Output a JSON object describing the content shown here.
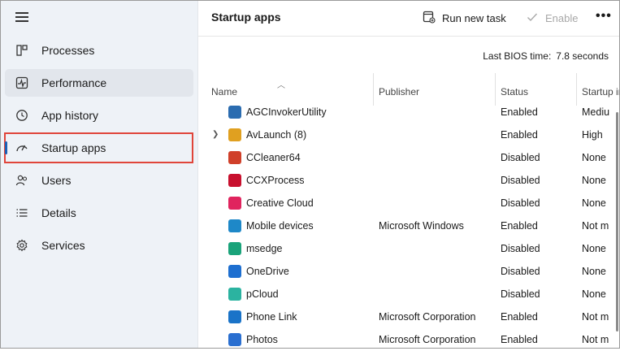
{
  "sidebar": {
    "items": [
      {
        "key": "processes",
        "label": "Processes",
        "icon": "processes-icon"
      },
      {
        "key": "performance",
        "label": "Performance",
        "icon": "performance-icon"
      },
      {
        "key": "app-history",
        "label": "App history",
        "icon": "history-icon"
      },
      {
        "key": "startup-apps",
        "label": "Startup apps",
        "icon": "startup-gauge-icon"
      },
      {
        "key": "users",
        "label": "Users",
        "icon": "users-icon"
      },
      {
        "key": "details",
        "label": "Details",
        "icon": "details-list-icon"
      },
      {
        "key": "services",
        "label": "Services",
        "icon": "services-gear-icon"
      }
    ],
    "selected": "Startup apps"
  },
  "header": {
    "title": "Startup apps",
    "run_new_task": "Run new task",
    "enable": "Enable",
    "more": "•••"
  },
  "bios": {
    "label": "Last BIOS time:",
    "value": "7.8 seconds"
  },
  "columns": {
    "name": "Name",
    "publisher": "Publisher",
    "status": "Status",
    "impact": "Startup im"
  },
  "rows": [
    {
      "name": "AGCInvokerUtility",
      "publisher": "",
      "status": "Enabled",
      "impact": "Mediu",
      "color": "#2b6cb0"
    },
    {
      "name": "AvLaunch (8)",
      "publisher": "",
      "status": "Enabled",
      "impact": "High",
      "color": "#e0a020",
      "expandable": true
    },
    {
      "name": "CCleaner64",
      "publisher": "",
      "status": "Disabled",
      "impact": "None",
      "color": "#d0402a"
    },
    {
      "name": "CCXProcess",
      "publisher": "",
      "status": "Disabled",
      "impact": "None",
      "color": "#c8102e"
    },
    {
      "name": "Creative Cloud",
      "publisher": "",
      "status": "Disabled",
      "impact": "None",
      "color": "#e0245e"
    },
    {
      "name": "Mobile devices",
      "publisher": "Microsoft Windows",
      "status": "Enabled",
      "impact": "Not m",
      "color": "#1e88c8"
    },
    {
      "name": "msedge",
      "publisher": "",
      "status": "Disabled",
      "impact": "None",
      "color": "#1aa37a"
    },
    {
      "name": "OneDrive",
      "publisher": "",
      "status": "Disabled",
      "impact": "None",
      "color": "#1e6fd0"
    },
    {
      "name": "pCloud",
      "publisher": "",
      "status": "Disabled",
      "impact": "None",
      "color": "#2bb3a0"
    },
    {
      "name": "Phone Link",
      "publisher": "Microsoft Corporation",
      "status": "Enabled",
      "impact": "Not m",
      "color": "#1a73c8"
    },
    {
      "name": "Photos",
      "publisher": "Microsoft Corporation",
      "status": "Enabled",
      "impact": "Not m",
      "color": "#2a6fd0"
    }
  ]
}
